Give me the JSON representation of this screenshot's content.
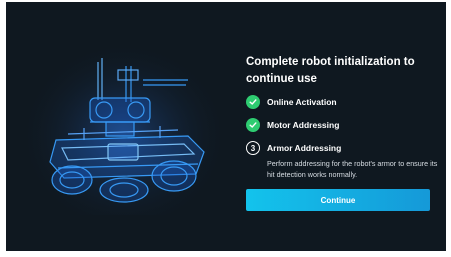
{
  "dialog": {
    "title": "Complete robot initialization to continue use",
    "steps": [
      {
        "label": "Online Activation",
        "status": "completed",
        "icon": "check-icon"
      },
      {
        "label": "Motor Addressing",
        "status": "completed",
        "icon": "check-icon"
      },
      {
        "label": "Armor Addressing",
        "status": "current",
        "number": "3",
        "description": "Perform addressing for the robot's armor to ensure its hit detection works normally."
      }
    ],
    "continue_label": "Continue"
  },
  "colors": {
    "background": "#0f1820",
    "accent": "#13c3ec",
    "success": "#2ecc71",
    "robot_glow": "#1e8fff"
  }
}
